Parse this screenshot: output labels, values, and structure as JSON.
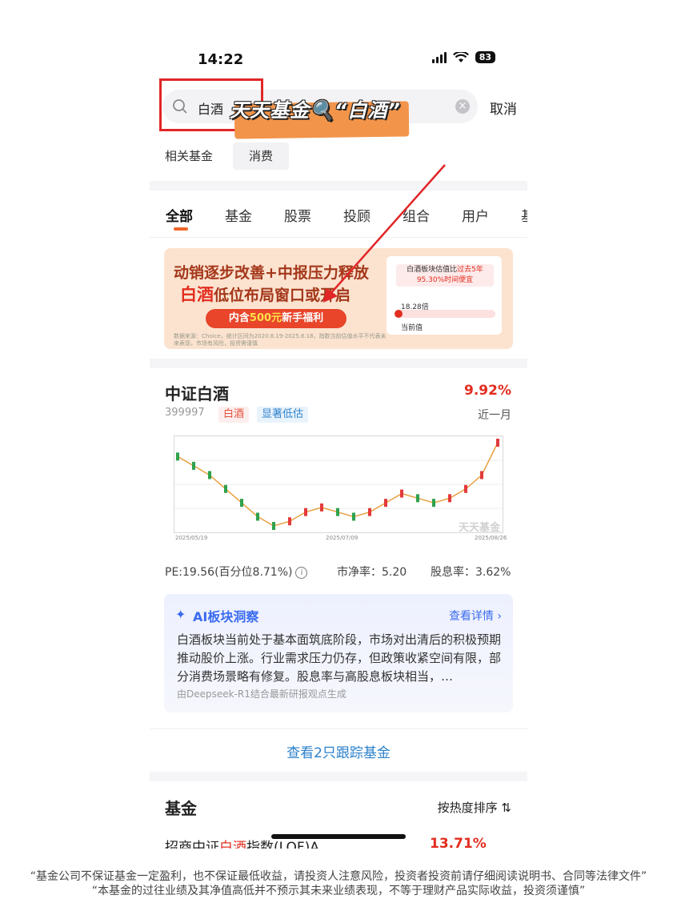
{
  "status_bar": {
    "time": "14:22",
    "battery": "83"
  },
  "search": {
    "query": "白酒",
    "cancel": "取消",
    "overlay_caption": "天天基金🔍“白酒”"
  },
  "related": {
    "label": "相关基金",
    "chip": "消费"
  },
  "tabs": [
    "全部",
    "基金",
    "股票",
    "投顾",
    "组合",
    "用户",
    "基"
  ],
  "banner": {
    "line1": "动销逐步改善+中报压力释放",
    "line2_highlight": "白酒",
    "line2_rest": "低位布局窗口或开启",
    "cta_prefix": "内含",
    "cta_amount": "500元",
    "cta_suffix": "新手福利",
    "disclaimer": "数据来源：Choice，统计区间为2020.8.19-2025.8.18，指数当前估值水平不代表未来表现，市场有风险，投资需谨慎",
    "card_title_a": "白酒板块估值比",
    "card_title_b": "过去5年",
    "card_title_c": "95.30%时间便宜",
    "card_value": "18.28倍",
    "card_label": "当前值"
  },
  "index": {
    "name": "中证白酒",
    "change": "9.92%",
    "code": "399997",
    "tag1": "白酒",
    "tag2": "显著低估",
    "period": "近一月",
    "watermark": "天天基金",
    "pe": "PE:19.56(百分位8.71%)",
    "pb": "市净率：5.20",
    "dividend": "股息率：3.62%"
  },
  "chart_data": {
    "type": "line",
    "x_ticks": [
      "2025/05/19",
      "2025/07/09",
      "2025/08/26"
    ],
    "series": [
      {
        "values": [
          1.0,
          0.98,
          0.96,
          0.93,
          0.9,
          0.87,
          0.85,
          0.86,
          0.88,
          0.89,
          0.88,
          0.87,
          0.88,
          0.9,
          0.92,
          0.91,
          0.9,
          0.91,
          0.93,
          0.96,
          1.03
        ]
      }
    ]
  },
  "ai": {
    "title": "AI板块洞察",
    "detail": "查看详情",
    "body": "白酒板块当前处于基本面筑底阶段，市场对出清后的积极预期推动股价上涨。行业需求压力仍存，但政策收紧空间有限，部分消费场景略有修复。股息率与高股息板块相当，…",
    "source": "由Deepseek-R1结合最新研报观点生成"
  },
  "track_button": "查看2只跟踪基金",
  "funds": {
    "header": "基金",
    "sort": "按热度排序",
    "row_prefix": "招商中证",
    "row_highlight": "白酒",
    "row_suffix": "指数(LOF)A",
    "row_value": "13.71%"
  },
  "disclaimer": {
    "line1": "“基金公司不保证基金一定盈利，也不保证最低收益，请投资人注意风险，投资者投资前请仔细阅读说明书、合同等法律文件”",
    "line2": "“本基金的过往业绩及其净值高低并不预示其未来业绩表现，不等于理财产品实际收益，投资须谨慎”"
  },
  "colors": {
    "accent_red": "#e22d1f",
    "link_blue": "#2d82cc",
    "ai_blue": "#3b6cf0",
    "tab_orange": "#f06528"
  }
}
